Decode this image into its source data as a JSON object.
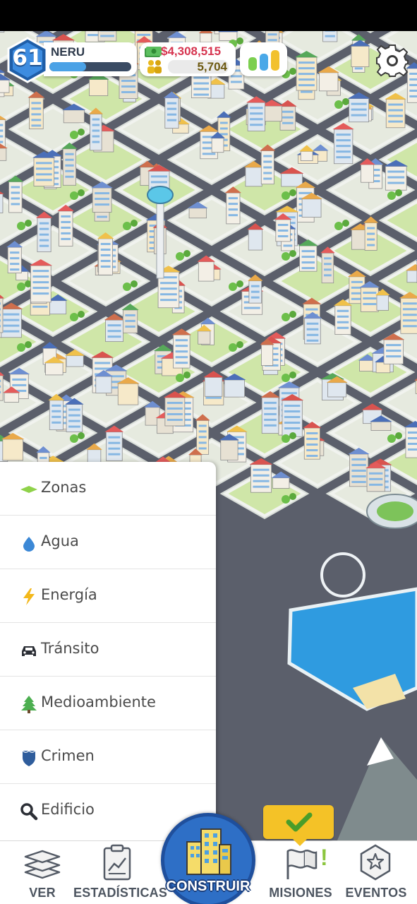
{
  "hud": {
    "level": "61",
    "player_name": "NERU",
    "xp_progress": 0.45,
    "money": "$4,308,515",
    "population": "5,704",
    "demand": {
      "residential": 0.55,
      "commercial": 0.7,
      "industrial": 0.85,
      "colors": [
        "#7ccf4f",
        "#4aa8e8",
        "#f2c12e"
      ]
    },
    "settings_icon": "gear-icon"
  },
  "build_menu": {
    "items": [
      {
        "label": "Zonas",
        "icon": "zone-diamond-icon",
        "color": "#8fd24a"
      },
      {
        "label": "Agua",
        "icon": "water-drop-icon",
        "color": "#3c88d6"
      },
      {
        "label": "Energía",
        "icon": "lightning-icon",
        "color": "#f3b81b"
      },
      {
        "label": "Tránsito",
        "icon": "car-icon",
        "color": "#2c2f36"
      },
      {
        "label": "Medioambiente",
        "icon": "tree-icon",
        "color": "#4caf50"
      },
      {
        "label": "Crimen",
        "icon": "police-badge-icon",
        "color": "#2f5d9c"
      },
      {
        "label": "Edificio",
        "icon": "magnifier-icon",
        "color": "#2c2f36"
      }
    ]
  },
  "bottom_nav": {
    "view": "VER",
    "stats": "ESTADÍSTICAS",
    "build": "CONSTRUIR",
    "missions": "MISIONES",
    "events": "EVENTOS"
  },
  "missions_badge": "!"
}
